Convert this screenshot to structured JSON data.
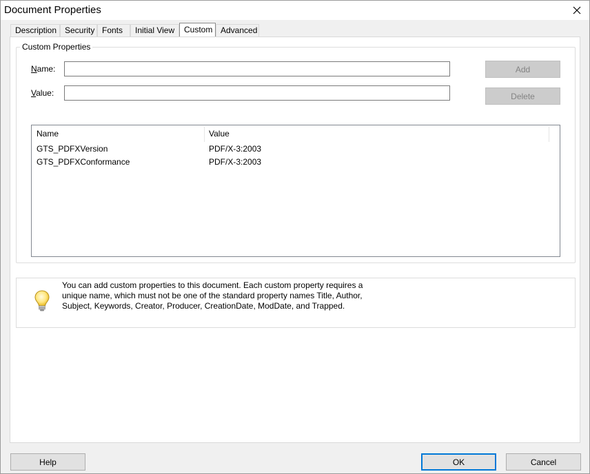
{
  "window": {
    "title": "Document Properties",
    "close_glyph": "✕"
  },
  "tabs": [
    {
      "label": "Description"
    },
    {
      "label": "Security"
    },
    {
      "label": "Fonts"
    },
    {
      "label": "Initial View"
    },
    {
      "label": "Custom"
    },
    {
      "label": "Advanced"
    }
  ],
  "active_tab": "Custom",
  "custom_properties": {
    "group_label": "Custom Properties",
    "name_label_prefix": "N",
    "name_label_rest": "ame:",
    "value_label_prefix": "V",
    "value_label_rest": "alue:",
    "name_value": "",
    "value_value": "",
    "add_label": "Add",
    "delete_label": "Delete"
  },
  "list": {
    "columns": [
      "Name",
      "Value"
    ],
    "rows": [
      {
        "name": "GTS_PDFXVersion",
        "value": "PDF/X-3:2003"
      },
      {
        "name": "GTS_PDFXConformance",
        "value": "PDF/X-3:2003"
      }
    ]
  },
  "info": {
    "icon": "lightbulb-icon",
    "text": "You can add custom properties to this document. Each custom property requires a unique name, which must not be one of the standard property names Title, Author, Subject, Keywords, Creator, Producer, CreationDate, ModDate, and Trapped."
  },
  "footer": {
    "help_label": "Help",
    "ok_label": "OK",
    "cancel_label": "Cancel"
  },
  "colors": {
    "accent": "#0078d7",
    "disabled_button_bg": "#cccccc",
    "disabled_button_text": "#838383"
  }
}
